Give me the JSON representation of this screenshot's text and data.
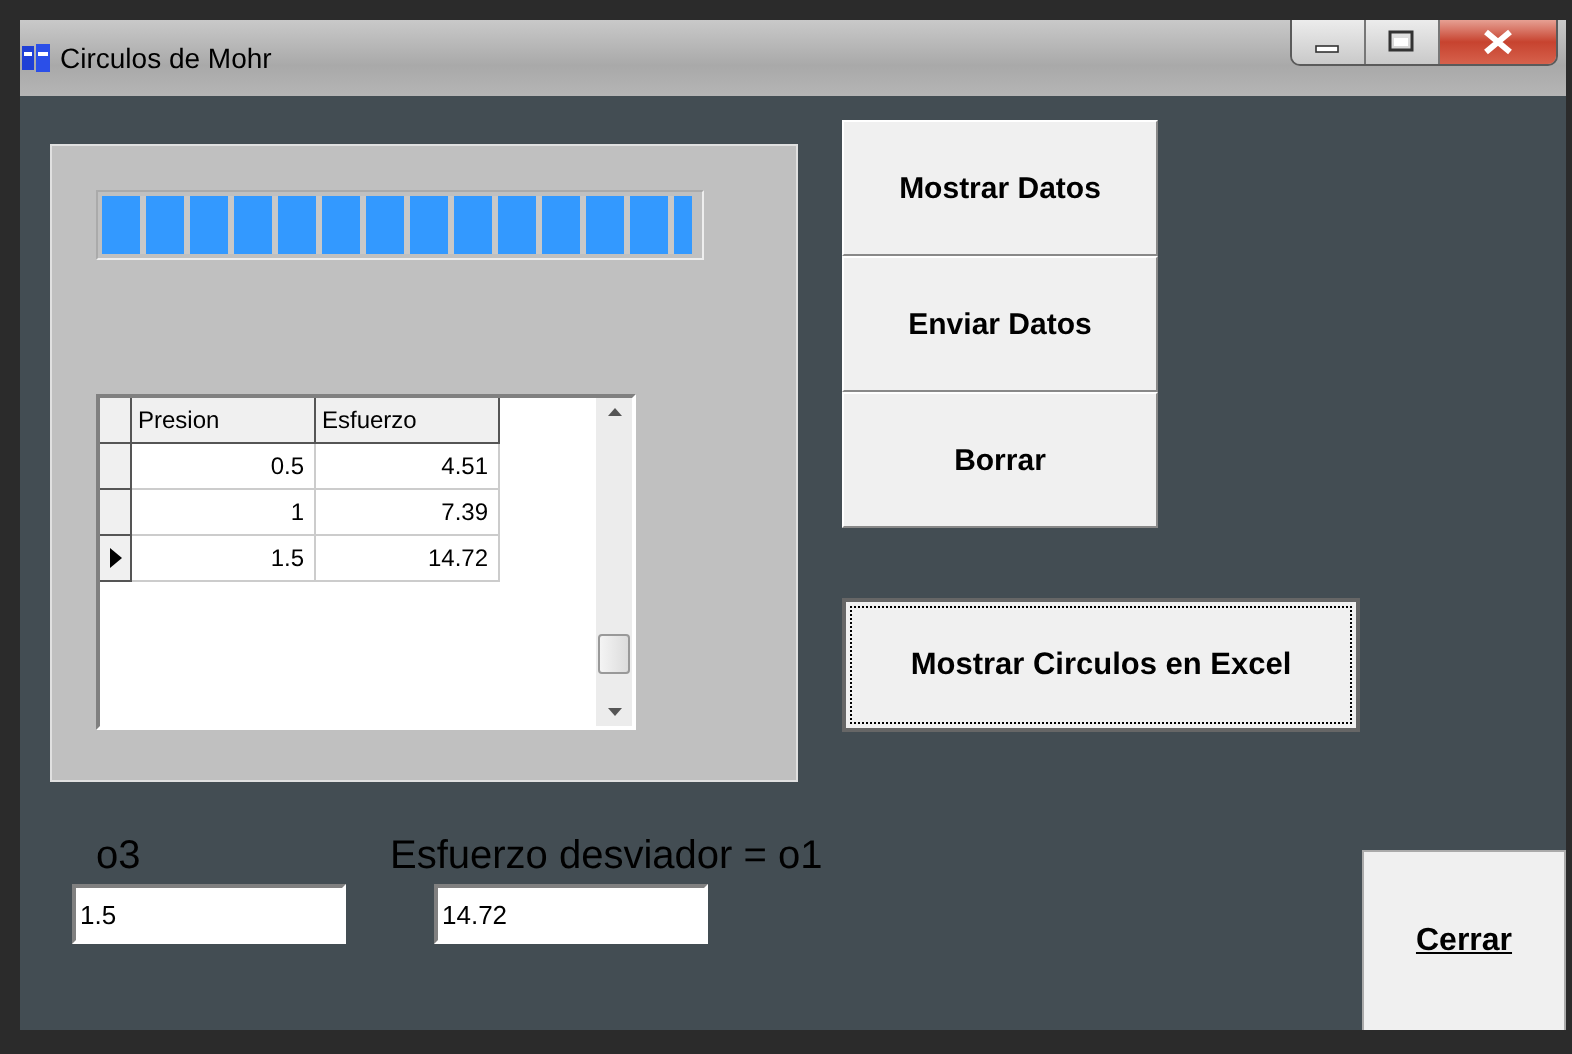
{
  "window": {
    "title": "Circulos de Mohr"
  },
  "progress": {
    "level": 0.99
  },
  "grid": {
    "columns": [
      "Presion",
      "Esfuerzo"
    ],
    "rows": [
      {
        "cells": [
          "0.5",
          "4.51"
        ],
        "selected": false
      },
      {
        "cells": [
          "1",
          "7.39"
        ],
        "selected": false
      },
      {
        "cells": [
          "1.5",
          "14.72"
        ],
        "selected": true
      }
    ]
  },
  "buttons": [
    "Mostrar Datos",
    "Enviar Datos",
    "Borrar"
  ],
  "excel_button": {
    "label": "Mostrar Circulos en Excel",
    "focused": true
  },
  "fields": [
    {
      "label": "o3",
      "value": "1.5"
    },
    {
      "label": "Esfuerzo desviador = o1",
      "value": "14.72"
    }
  ],
  "close_button": {
    "label": "Cerrar"
  }
}
